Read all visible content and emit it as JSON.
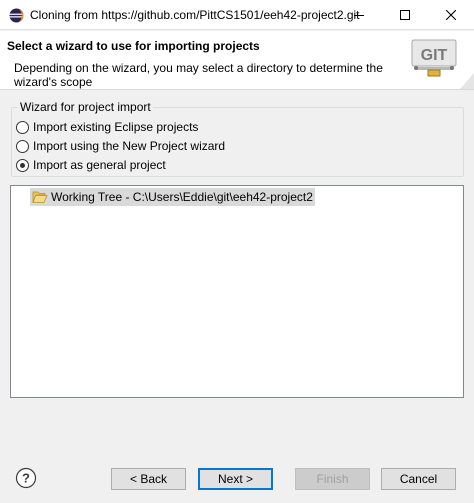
{
  "window": {
    "title": "Cloning from https://github.com/PittCS1501/eeh42-project2.git",
    "icons": {
      "app": "eclipse-icon",
      "minimize": "minimize-icon",
      "maximize": "maximize-icon",
      "close": "close-icon"
    }
  },
  "banner": {
    "title": "Select a wizard to use for importing projects",
    "description": "Depending on the wizard, you may select a directory to determine the wizard's scope",
    "logo_text": "GIT"
  },
  "wizard_group": {
    "label": "Wizard for project import",
    "options": [
      {
        "label": "Import existing Eclipse projects",
        "checked": false
      },
      {
        "label": "Import using the New Project wizard",
        "checked": false
      },
      {
        "label": "Import as general project",
        "checked": true
      }
    ]
  },
  "tree": {
    "items": [
      {
        "label": "Working Tree - C:\\Users\\Eddie\\git\\eeh42-project2",
        "icon": "folder-open-icon",
        "selected": true
      }
    ]
  },
  "footer": {
    "help_icon": "help-icon",
    "back_label": "< Back",
    "next_label": "Next >",
    "finish_label": "Finish",
    "cancel_label": "Cancel",
    "finish_disabled": true
  },
  "colors": {
    "accent": "#0078d7",
    "background": "#f0f0f0",
    "selection": "#d9d9d9"
  }
}
